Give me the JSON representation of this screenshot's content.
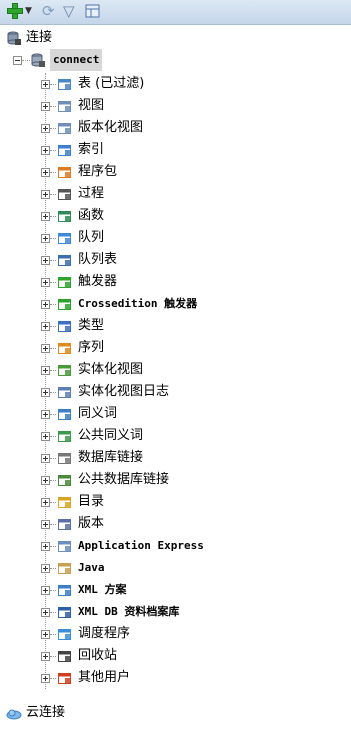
{
  "toolbar": {
    "add_icon": "add-connection-icon",
    "dropdown_icon": "chevron-down-icon",
    "refresh_icon": "refresh-icon",
    "filter_icon": "filter-icon",
    "schema_icon": "schema-browser-icon"
  },
  "tree": {
    "connections_label": "连接",
    "connection_name": "connect",
    "cloud_label": "云连接",
    "nodes": [
      {
        "label": "表 (已过滤)",
        "icon": "table-icon",
        "color": "#4a86c8"
      },
      {
        "label": "视图",
        "icon": "view-icon",
        "color": "#6f8fb8"
      },
      {
        "label": "版本化视图",
        "icon": "editioned-view-icon",
        "color": "#6f8fb8"
      },
      {
        "label": "索引",
        "icon": "index-icon",
        "color": "#3d7fd0"
      },
      {
        "label": "程序包",
        "icon": "package-icon",
        "color": "#e07a20"
      },
      {
        "label": "过程",
        "icon": "procedure-icon",
        "color": "#555555"
      },
      {
        "label": "函数",
        "icon": "function-icon",
        "color": "#2e8b57"
      },
      {
        "label": "队列",
        "icon": "queue-icon",
        "color": "#3c8ad8"
      },
      {
        "label": "队列表",
        "icon": "queue-table-icon",
        "color": "#3b6fb0"
      },
      {
        "label": "触发器",
        "icon": "trigger-icon",
        "color": "#2aa52a"
      },
      {
        "label": "Crossedition 触发器",
        "icon": "crossedition-trigger-icon",
        "color": "#2aa52a"
      },
      {
        "label": "类型",
        "icon": "type-icon",
        "color": "#3a6fc4"
      },
      {
        "label": "序列",
        "icon": "sequence-icon",
        "color": "#e08a1e"
      },
      {
        "label": "实体化视图",
        "icon": "materialized-view-icon",
        "color": "#4a9a3a"
      },
      {
        "label": "实体化视图日志",
        "icon": "materialized-view-log-icon",
        "color": "#5b7fb3"
      },
      {
        "label": "同义词",
        "icon": "synonym-icon",
        "color": "#3b7fc4"
      },
      {
        "label": "公共同义词",
        "icon": "public-synonym-icon",
        "color": "#3b9a4a"
      },
      {
        "label": "数据库链接",
        "icon": "database-link-icon",
        "color": "#777777"
      },
      {
        "label": "公共数据库链接",
        "icon": "public-database-link-icon",
        "color": "#4a8a3a"
      },
      {
        "label": "目录",
        "icon": "directory-icon",
        "color": "#d9a520"
      },
      {
        "label": "版本",
        "icon": "edition-icon",
        "color": "#5a6fa8"
      },
      {
        "label": "Application Express",
        "icon": "application-express-icon",
        "color": "#6c8ebf"
      },
      {
        "label": "Java",
        "icon": "java-icon",
        "color": "#c8a050"
      },
      {
        "label": "XML 方案",
        "icon": "xml-schema-icon",
        "color": "#3a7fc8"
      },
      {
        "label": "XML DB 资料档案库",
        "icon": "xml-db-repository-icon",
        "color": "#2b5fa8"
      },
      {
        "label": "调度程序",
        "icon": "scheduler-icon",
        "color": "#3a8fd8"
      },
      {
        "label": "回收站",
        "icon": "recycle-bin-icon",
        "color": "#444444"
      },
      {
        "label": "其他用户",
        "icon": "other-users-icon",
        "color": "#d04020"
      }
    ]
  }
}
